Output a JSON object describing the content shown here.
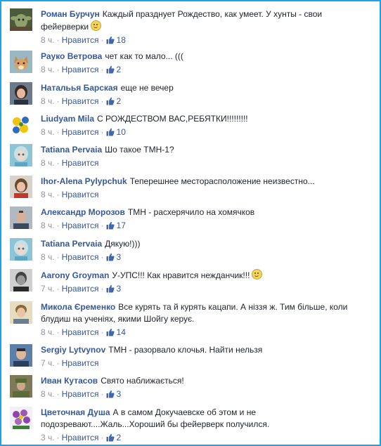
{
  "like_label": "Нравится",
  "colors": {
    "author": "#365899",
    "meta": "#90949c",
    "border": "#1aa3e8",
    "thumb": "#4267b2"
  },
  "comments": [
    {
      "author": "Роман Бурчун",
      "text": "Каждый празднует Рождество, как умеет. У хунты - свои фейерверки",
      "smiley": true,
      "time": "8 ч.",
      "likes": "18",
      "avatar": "yoda"
    },
    {
      "author": "Рауко Ветрова",
      "text": "чет как то мало... (((",
      "time": "8 ч.",
      "likes": "2",
      "avatar": "fox"
    },
    {
      "author": "Натальья Барская",
      "text": "еще не вечер",
      "time": "8 ч.",
      "likes": "2",
      "avatar": "woman-dark"
    },
    {
      "author": "Liudyam Mila",
      "text": "С РОЖДЕСТВОМ ВАС,РЕБЯТКИ!!!!!!!!!",
      "time": "8 ч.",
      "likes": "10",
      "avatar": "flowers"
    },
    {
      "author": "Tatiana Pervaia",
      "text": "Шо такое ТМН-1?",
      "time": "8 ч.",
      "likes": "",
      "avatar": "doll"
    },
    {
      "author": "Ihor-Alena Pylypchuk",
      "text": "Теперешнее месторасположение неизвестно...",
      "time": "8 ч.",
      "likes": "",
      "avatar": "woman"
    },
    {
      "author": "Александр Морозов",
      "text": "ТМН - расхерячило на хомячков",
      "time": "8 ч.",
      "likes": "17",
      "avatar": "man"
    },
    {
      "author": "Tatiana Pervaia",
      "text": "Дякую!)))",
      "time": "8 ч.",
      "likes": "3",
      "avatar": "doll"
    },
    {
      "author": "Aarony Groyman",
      "text": "У-УПС!!! Как нравится нежданчик!!!",
      "smiley": true,
      "time": "7 ч.",
      "likes": "3",
      "avatar": "man-bw"
    },
    {
      "author": "Микола Єременко",
      "text": "Все курять та й курять кацапи. А ніззя ж. Тим більше, коли блудиш на учeніях, якими Шойгу керує.",
      "time": "8 ч.",
      "likes": "14",
      "avatar": "man-light"
    },
    {
      "author": "Sergiy Lytvynov",
      "text": "ТМН - разорвало клочья. Найти нельзя",
      "time": "7 ч.",
      "likes": "",
      "avatar": "man-blue"
    },
    {
      "author": "Иван Кутасов",
      "text": "Свято наближається!",
      "time": "8 ч.",
      "likes": "3",
      "avatar": "soldier"
    },
    {
      "author": "Цветочная Душа",
      "text": "А в самом Докучаевске об этом и не подозревают....Жаль...Хороший бы фейерверк получился.",
      "time": "3 ч.",
      "likes": "2",
      "avatar": "violets"
    }
  ]
}
